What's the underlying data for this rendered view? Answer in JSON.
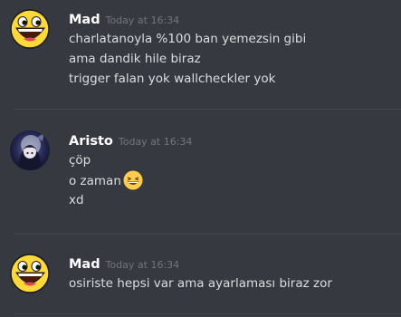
{
  "messages": [
    {
      "author": "Mad",
      "avatar_icon": "awesome-face-icon",
      "timestamp": "Today at 16:34",
      "lines": [
        "charlatanoyla %100 ban yemezsin gibi",
        "ama dandik hile biraz",
        "trigger falan yok wallcheckler yok"
      ]
    },
    {
      "author": "Aristo",
      "avatar_icon": "dark-anime-avatar-icon",
      "timestamp": "Today at 16:34",
      "lines": [
        "çöp",
        "o zaman",
        "xd"
      ],
      "emoji": "grinning-squinting-face-emoji"
    },
    {
      "author": "Mad",
      "avatar_icon": "awesome-face-icon",
      "timestamp": "Today at 16:34",
      "lines": [
        "osiriste hepsi var ama ayarlaması biraz zor"
      ]
    }
  ],
  "colors": {
    "background": "#36393f",
    "username": "#ffffff",
    "text": "#dcddde",
    "timestamp": "#72767d",
    "divider": "#42454a"
  }
}
